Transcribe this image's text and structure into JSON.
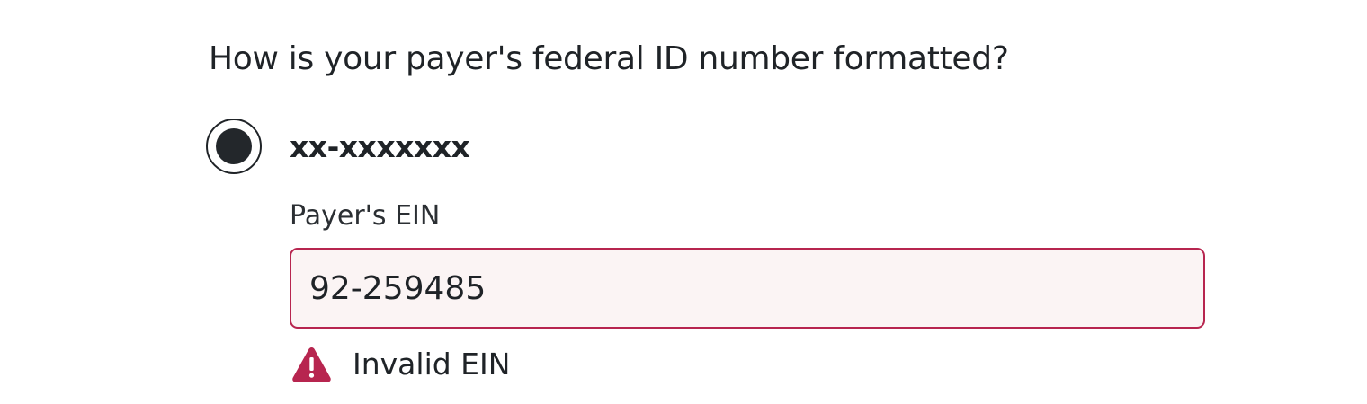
{
  "question": {
    "text": "How is your payer's federal ID number formatted?"
  },
  "format_option": {
    "label": "xx-xxxxxxx",
    "selected": true
  },
  "ein_field": {
    "label": "Payer's EIN",
    "value": "92-259485"
  },
  "error": {
    "message": "Invalid EIN",
    "icon": "warning-icon",
    "color": "#b7254f"
  },
  "colors": {
    "error_border": "#b7254f",
    "error_background": "#fbf4f4",
    "text": "#1f2327"
  }
}
